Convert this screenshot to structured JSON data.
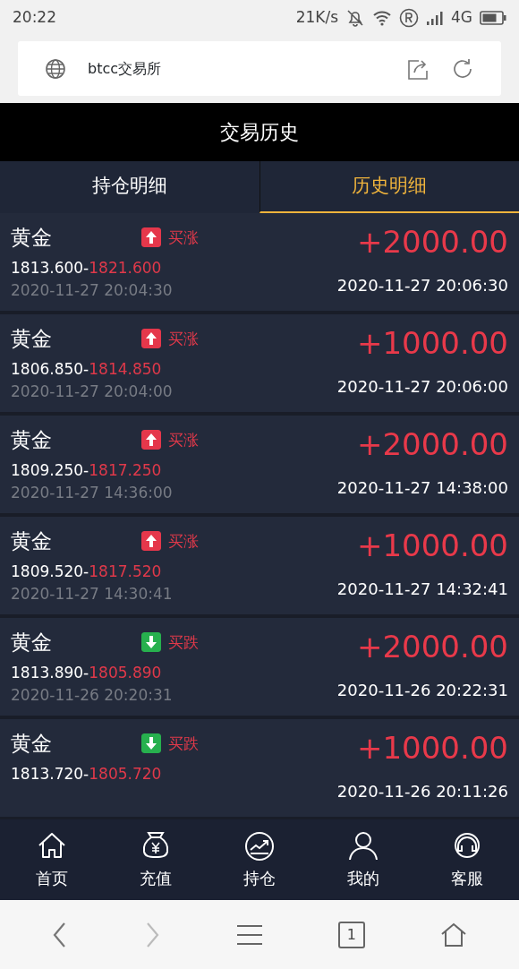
{
  "status_bar": {
    "time": "20:22",
    "speed": "21K/s",
    "network": "4G"
  },
  "browser": {
    "title": "btcc交易所",
    "tab_count": "1"
  },
  "header": {
    "title": "交易历史"
  },
  "tabs": [
    {
      "label": "持仓明细",
      "selected": false
    },
    {
      "label": "历史明细",
      "selected": true
    }
  ],
  "trades": [
    {
      "name": "黄金",
      "kind": "up",
      "direction_label": "买涨",
      "open_price": "1813.600-",
      "close_price": "1821.600",
      "open_time": "2020-11-27 20:04:30",
      "profit": "+2000.00",
      "close_time": "2020-11-27 20:06:30"
    },
    {
      "name": "黄金",
      "kind": "up",
      "direction_label": "买涨",
      "open_price": "1806.850-",
      "close_price": "1814.850",
      "open_time": "2020-11-27 20:04:00",
      "profit": "+1000.00",
      "close_time": "2020-11-27 20:06:00"
    },
    {
      "name": "黄金",
      "kind": "up",
      "direction_label": "买涨",
      "open_price": "1809.250-",
      "close_price": "1817.250",
      "open_time": "2020-11-27 14:36:00",
      "profit": "+2000.00",
      "close_time": "2020-11-27 14:38:00"
    },
    {
      "name": "黄金",
      "kind": "up",
      "direction_label": "买涨",
      "open_price": "1809.520-",
      "close_price": "1817.520",
      "open_time": "2020-11-27 14:30:41",
      "profit": "+1000.00",
      "close_time": "2020-11-27 14:32:41"
    },
    {
      "name": "黄金",
      "kind": "down",
      "direction_label": "买跌",
      "open_price": "1813.890-",
      "close_price": "1805.890",
      "open_time": "2020-11-26 20:20:31",
      "profit": "+2000.00",
      "close_time": "2020-11-26 20:22:31"
    },
    {
      "name": "黄金",
      "kind": "down",
      "direction_label": "买跌",
      "open_price": "1813.720-",
      "close_price": "1805.720",
      "profit": "+1000.00",
      "close_time": "2020-11-26 20:11:26"
    }
  ],
  "bottom_nav": [
    {
      "kind": "home",
      "label": "首页"
    },
    {
      "kind": "money",
      "label": "充值"
    },
    {
      "kind": "chart",
      "label": "持仓"
    },
    {
      "kind": "user",
      "label": "我的"
    },
    {
      "kind": "service",
      "label": "客服"
    }
  ]
}
